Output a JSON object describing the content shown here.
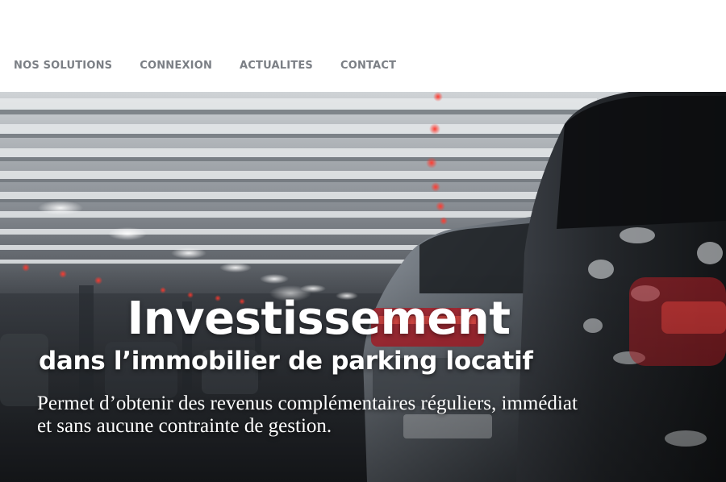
{
  "nav": {
    "items": [
      {
        "label": "NOS SOLUTIONS"
      },
      {
        "label": "CONNEXION"
      },
      {
        "label": "ACTUALITES"
      },
      {
        "label": "CONTACT"
      }
    ]
  },
  "hero": {
    "title": "Investissement",
    "subtitle": "dans l’immobilier de parking locatif",
    "description": "Permet d’obtenir des revenus complémentaires réguliers, immédiat et sans aucune contrainte de gestion."
  }
}
